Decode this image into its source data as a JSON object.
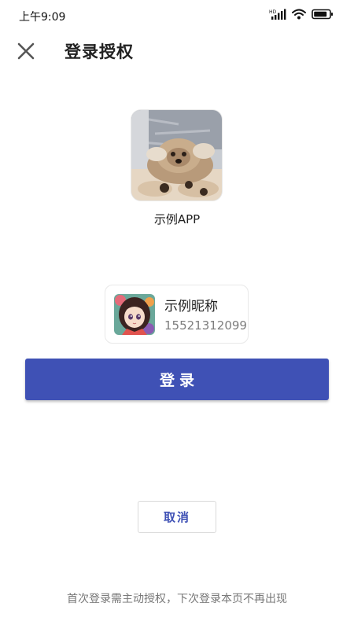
{
  "status_bar": {
    "time": "上午9:09",
    "network_label": "HD",
    "icons": [
      "signal-icon",
      "wifi-icon",
      "battery-icon"
    ]
  },
  "header": {
    "close_icon": "close-icon",
    "title": "登录授权"
  },
  "app": {
    "logo": "dog-photo",
    "name": "示例APP"
  },
  "account": {
    "avatar": "anime-girl-avatar",
    "nickname": "示例昵称",
    "phone": "15521312099"
  },
  "actions": {
    "login_label": "登录",
    "cancel_label": "取消"
  },
  "footer": {
    "note": "首次登录需主动授权，下次登录本页不再出现"
  },
  "colors": {
    "primary": "#3f51b5",
    "text": "#222222",
    "secondary_text": "#7d7d7d",
    "border": "#e8e8e8"
  }
}
